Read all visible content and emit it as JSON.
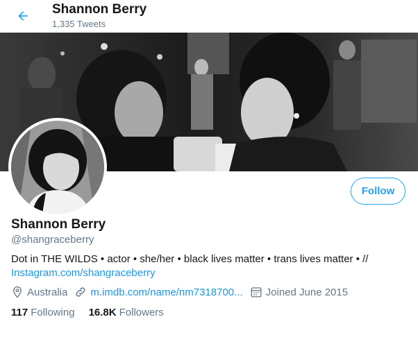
{
  "header": {
    "name": "Shannon Berry",
    "tweet_count": "1,335 Tweets"
  },
  "profile": {
    "name": "Shannon Berry",
    "handle": "@shangraceberry",
    "follow_label": "Follow",
    "bio_text": "Dot in THE WILDS • actor • she/her • black lives matter • trans lives matter • //",
    "bio_link": "Instagram.com/shangraceberry",
    "location": "Australia",
    "website": "m.imdb.com/name/nm7318700...",
    "joined": "Joined June 2015",
    "following_count": "117",
    "following_label": "Following",
    "followers_count": "16.8K",
    "followers_label": "Followers"
  },
  "icons": {
    "back": "back-arrow-icon",
    "location": "location-pin-icon",
    "website": "link-icon",
    "joined": "calendar-icon"
  },
  "colors": {
    "accent": "#1da1f2",
    "link": "#1b95e0",
    "secondary_text": "#657786"
  }
}
